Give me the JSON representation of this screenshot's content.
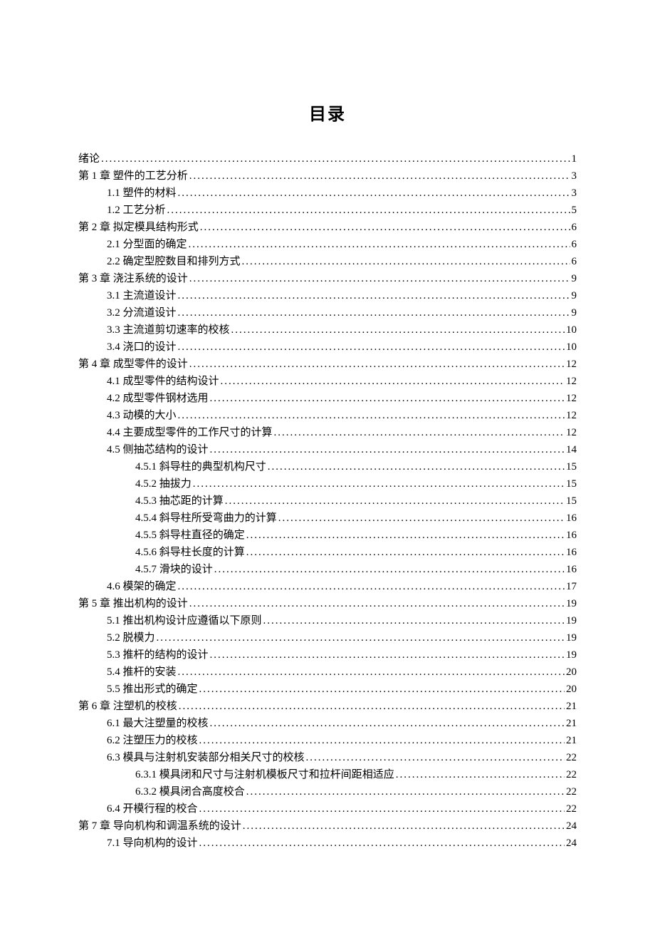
{
  "doc_title": "目录",
  "toc": [
    {
      "label": "绪论",
      "page": "1",
      "level": 0
    },
    {
      "label": "第 1 章  塑件的工艺分析",
      "page": "3",
      "level": 0
    },
    {
      "label": "1.1  塑件的材料",
      "page": "3",
      "level": 1
    },
    {
      "label": "1.2  工艺分析",
      "page": "5",
      "level": 1
    },
    {
      "label": "第 2 章  拟定模具结构形式",
      "page": "6",
      "level": 0
    },
    {
      "label": "2.1  分型面的确定",
      "page": "6",
      "level": 1
    },
    {
      "label": "2.2  确定型腔数目和排列方式",
      "page": "6",
      "level": 1
    },
    {
      "label": "第 3 章  浇注系统的设计",
      "page": "9",
      "level": 0
    },
    {
      "label": "3.1  主流道设计",
      "page": "9",
      "level": 1
    },
    {
      "label": "3.2  分流道设计",
      "page": "9",
      "level": 1
    },
    {
      "label": "3.3  主流道剪切速率的校核",
      "page": "10",
      "level": 1
    },
    {
      "label": "3.4 浇口的设计",
      "page": "10",
      "level": 1
    },
    {
      "label": "第 4 章  成型零件的设计",
      "page": "12",
      "level": 0
    },
    {
      "label": "4.1  成型零件的结构设计",
      "page": "12",
      "level": 1
    },
    {
      "label": "4.2  成型零件钢材选用",
      "page": "12",
      "level": 1
    },
    {
      "label": "4.3  动模的大小",
      "page": "12",
      "level": 1
    },
    {
      "label": "4.4 主要成型零件的工作尺寸的计算",
      "page": "12",
      "level": 1
    },
    {
      "label": "4.5  侧抽芯结构的设计",
      "page": "14",
      "level": 1
    },
    {
      "label": "4.5.1  斜导柱的典型机构尺寸",
      "page": "15",
      "level": 2
    },
    {
      "label": "4.5.2  抽拔力",
      "page": "15",
      "level": 2
    },
    {
      "label": "4.5.3  抽芯距的计算",
      "page": "15",
      "level": 2
    },
    {
      "label": "4.5.4  斜导柱所受弯曲力的计算",
      "page": "16",
      "level": 2
    },
    {
      "label": "4.5.5  斜导柱直径的确定",
      "page": "16",
      "level": 2
    },
    {
      "label": "4.5.6  斜导柱长度的计算",
      "page": "16",
      "level": 2
    },
    {
      "label": "4.5.7  滑块的设计",
      "page": "16",
      "level": 2
    },
    {
      "label": "4.6  模架的确定",
      "page": "17",
      "level": 1
    },
    {
      "label": "第 5 章  推出机构的设计",
      "page": "19",
      "level": 0
    },
    {
      "label": "5.1  推出机构设计应遵循以下原则",
      "page": "19",
      "level": 1
    },
    {
      "label": "5.2  脱模力",
      "page": "19",
      "level": 1
    },
    {
      "label": "5.3  推杆的结构的设计",
      "page": "19",
      "level": 1
    },
    {
      "label": "5.4 推杆的安装",
      "page": "20",
      "level": 1
    },
    {
      "label": "5.5  推出形式的确定",
      "page": "20",
      "level": 1
    },
    {
      "label": "第 6 章  注塑机的校核",
      "page": "21",
      "level": 0
    },
    {
      "label": "6.1  最大注塑量的校核",
      "page": "21",
      "level": 1
    },
    {
      "label": "6.2  注塑压力的校核",
      "page": "21",
      "level": 1
    },
    {
      "label": "6.3 模具与注射机安装部分相关尺寸的校核",
      "page": "22",
      "level": 1
    },
    {
      "label": "6.3.1  模具闭和尺寸与注射机模板尺寸和拉杆间距相适应",
      "page": "22",
      "level": 2
    },
    {
      "label": "6.3.2  模具闭合高度校合",
      "page": "22",
      "level": 2
    },
    {
      "label": "6.4  开模行程的校合",
      "page": "22",
      "level": 1
    },
    {
      "label": "第 7 章  导向机构和调温系统的设计",
      "page": "24",
      "level": 0
    },
    {
      "label": "7.1 导向机构的设计",
      "page": "24",
      "level": 1
    }
  ]
}
